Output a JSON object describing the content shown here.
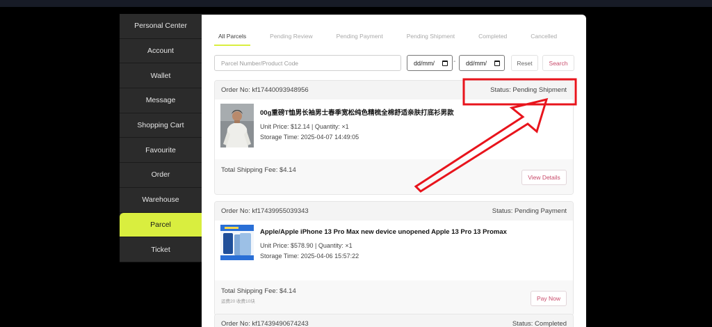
{
  "sidebar": {
    "items": [
      {
        "label": "Personal Center",
        "active": false
      },
      {
        "label": "Account",
        "active": false
      },
      {
        "label": "Wallet",
        "active": false
      },
      {
        "label": "Message",
        "active": false
      },
      {
        "label": "Shopping Cart",
        "active": false
      },
      {
        "label": "Favourite",
        "active": false
      },
      {
        "label": "Order",
        "active": false
      },
      {
        "label": "Warehouse",
        "active": false
      },
      {
        "label": "Parcel",
        "active": true
      },
      {
        "label": "Ticket",
        "active": false
      }
    ]
  },
  "tabs": [
    {
      "label": "All Parcels",
      "active": true
    },
    {
      "label": "Pending Review",
      "active": false
    },
    {
      "label": "Pending Payment",
      "active": false
    },
    {
      "label": "Pending Shipment",
      "active": false
    },
    {
      "label": "Completed",
      "active": false
    },
    {
      "label": "Cancelled",
      "active": false
    }
  ],
  "filters": {
    "search_placeholder": "Parcel Number/Product Code",
    "date_from": "dd/mm/",
    "date_to": "dd/mm/",
    "separator": "-",
    "reset_label": "Reset",
    "search_label": "Search"
  },
  "orders": [
    {
      "order_no": "Order No: kf17440093948956",
      "status": "Status: Pending Shipment",
      "product_name": "00g重磅T恤男长袖男士春季宽松纯色精梳全棉舒适亲肤打底衫男款",
      "price_qty": "Unit Price: $12.14 | Quantity: ×1",
      "storage_time": "Storage Time: 2025-04-07 14:49:05",
      "shipping_fee": "Total Shipping Fee: $4.14",
      "ship_note": "",
      "action": "View Details"
    },
    {
      "order_no": "Order No: kf17439955039343",
      "status": "Status: Pending Payment",
      "product_name": "Apple/Apple iPhone 13 Pro Max new device unopened Apple 13 Pro 13 Promax",
      "price_qty": "Unit Price: $578.90 | Quantity: ×1",
      "storage_time": "Storage Time: 2025-04-06 15:57:22",
      "shipping_fee": "Total Shipping Fee: $4.14",
      "ship_note": "运费20 收费10块",
      "action": "Pay Now"
    },
    {
      "order_no": "Order No: kf17439490674243",
      "status": "Status: Completed"
    }
  ],
  "colors": {
    "accent": "#d9ee3f",
    "sidebar_bg": "#2b2b2b",
    "action_text": "#c84a6a",
    "annotation_red": "#e8141c"
  }
}
